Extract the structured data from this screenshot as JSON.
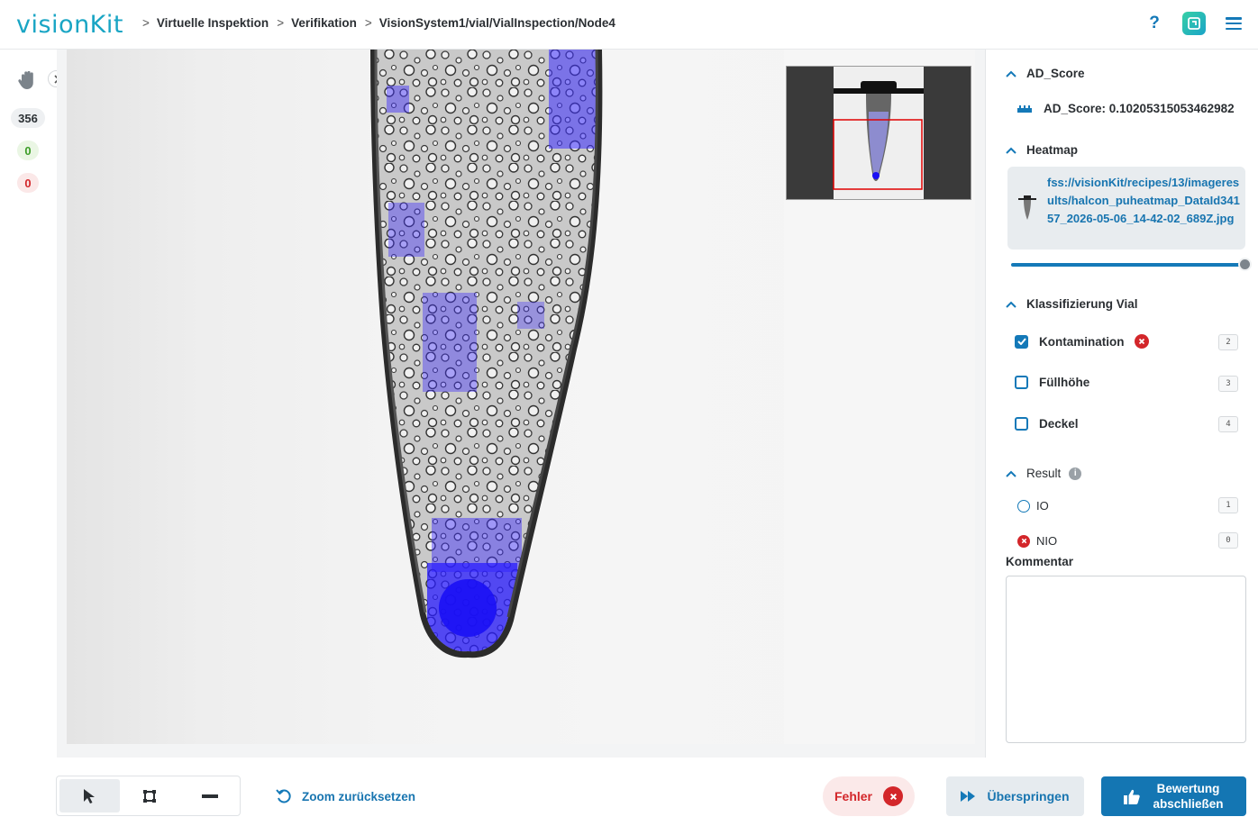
{
  "app": {
    "logo": "visionKit"
  },
  "breadcrumb": [
    "Virtuelle Inspektion",
    "Verifikation",
    "VisionSystem1/vial/VialInspection/Node4"
  ],
  "header": {
    "help_label": "?"
  },
  "counters": {
    "total": "356",
    "ok": "0",
    "nok": "0"
  },
  "panel": {
    "ad_score": {
      "title": "AD_Score",
      "value_label": "AD_Score: 0.10205315053462982"
    },
    "heatmap": {
      "title": "Heatmap",
      "link": "fss://visionKit/recipes/13/imageresults/halcon_puheatmap_DataId34157_2026-05-06_14-42-02_689Z.jpg",
      "opacity": 1.0
    },
    "classification": {
      "title": "Klassifizierung Vial",
      "items": [
        {
          "label": "Kontamination",
          "checked": true,
          "error": true,
          "key": "2"
        },
        {
          "label": "Füllhöhe",
          "checked": false,
          "error": false,
          "key": "3"
        },
        {
          "label": "Deckel",
          "checked": false,
          "error": false,
          "key": "4"
        }
      ]
    },
    "result": {
      "title": "Result",
      "info": "i",
      "options": [
        {
          "label": "IO",
          "key": "1",
          "selected": false
        },
        {
          "label": "NIO",
          "key": "0",
          "selected": true
        }
      ]
    },
    "comment": {
      "label": "Kommentar",
      "value": ""
    }
  },
  "toolbar": {
    "zoom_reset": "Zoom zurücksetzen",
    "error": "Fehler",
    "skip": "Überspringen",
    "finish_line1": "Bewertung",
    "finish_line2": "abschließen"
  },
  "colors": {
    "accent": "#1479b8",
    "error": "#d3262a",
    "ok": "#3c9d27",
    "logo": "#19a5c4"
  }
}
